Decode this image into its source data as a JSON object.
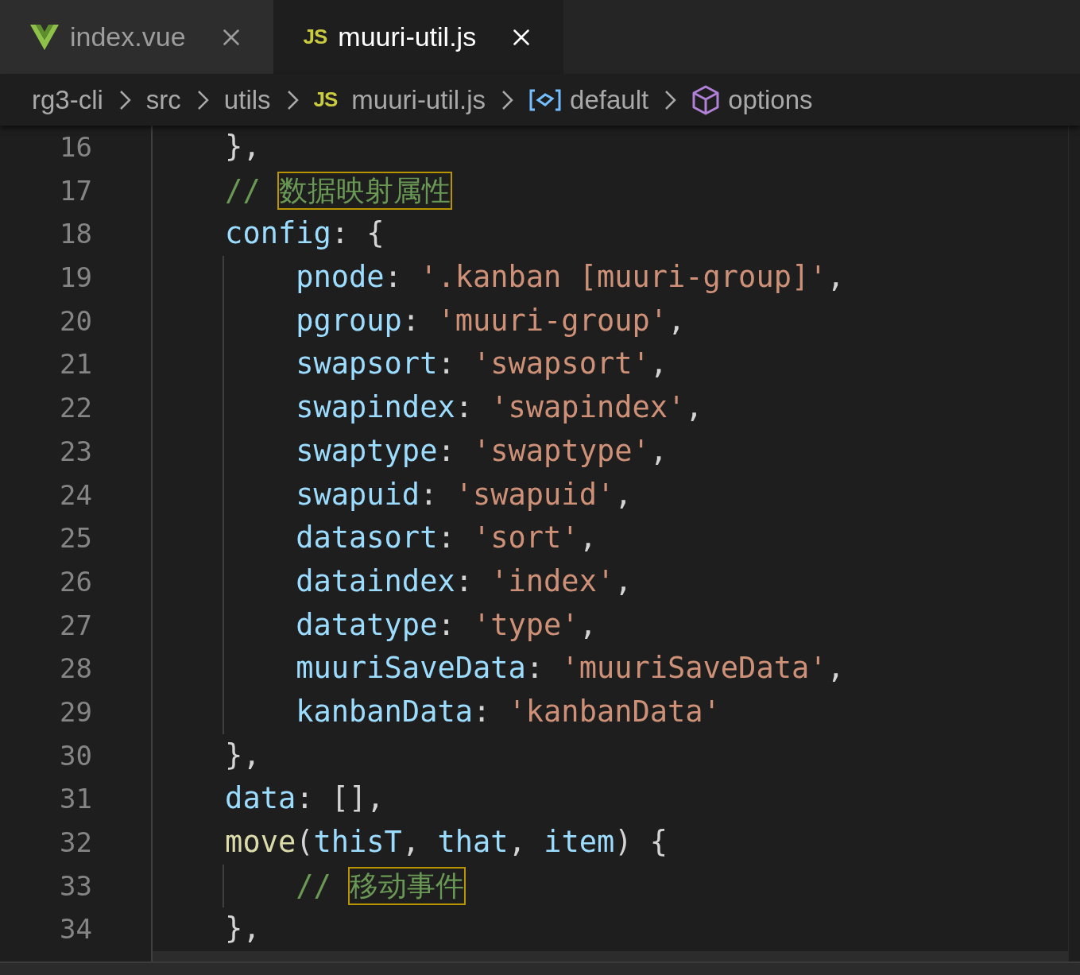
{
  "tabs": [
    {
      "kind": "vue",
      "label": "index.vue",
      "selected": false
    },
    {
      "kind": "js",
      "icon_text": "JS",
      "label": "muuri-util.js",
      "selected": true
    }
  ],
  "breadcrumbs": [
    {
      "kind": "folder",
      "label": "rg3-cli"
    },
    {
      "kind": "folder",
      "label": "src"
    },
    {
      "kind": "folder",
      "label": "utils"
    },
    {
      "kind": "js",
      "icon_text": "JS",
      "label": "muuri-util.js"
    },
    {
      "kind": "module",
      "label": "default"
    },
    {
      "kind": "property",
      "label": "options"
    }
  ],
  "lines": [
    {
      "number": "16",
      "tokens": [
        {
          "kind": "punct",
          "text": "    },"
        }
      ]
    },
    {
      "number": "17",
      "tokens": [
        {
          "kind": "comment",
          "text": "    // "
        },
        {
          "kind": "comment-highlighted",
          "text": "数据映射属性"
        }
      ]
    },
    {
      "number": "18",
      "tokens": [
        {
          "kind": "key",
          "text": "    config"
        },
        {
          "kind": "punct",
          "text": ": {"
        }
      ]
    },
    {
      "number": "19",
      "tokens": [
        {
          "kind": "key",
          "text": "        pnode"
        },
        {
          "kind": "punct",
          "text": ": "
        },
        {
          "kind": "string",
          "text": "'.kanban [muuri-group]'"
        },
        {
          "kind": "punct",
          "text": ","
        }
      ]
    },
    {
      "number": "20",
      "tokens": [
        {
          "kind": "key",
          "text": "        pgroup"
        },
        {
          "kind": "punct",
          "text": ": "
        },
        {
          "kind": "string",
          "text": "'muuri-group'"
        },
        {
          "kind": "punct",
          "text": ","
        }
      ]
    },
    {
      "number": "21",
      "tokens": [
        {
          "kind": "key",
          "text": "        swapsort"
        },
        {
          "kind": "punct",
          "text": ": "
        },
        {
          "kind": "string",
          "text": "'swapsort'"
        },
        {
          "kind": "punct",
          "text": ","
        }
      ]
    },
    {
      "number": "22",
      "tokens": [
        {
          "kind": "key",
          "text": "        swapindex"
        },
        {
          "kind": "punct",
          "text": ": "
        },
        {
          "kind": "string",
          "text": "'swapindex'"
        },
        {
          "kind": "punct",
          "text": ","
        }
      ]
    },
    {
      "number": "23",
      "tokens": [
        {
          "kind": "key",
          "text": "        swaptype"
        },
        {
          "kind": "punct",
          "text": ": "
        },
        {
          "kind": "string",
          "text": "'swaptype'"
        },
        {
          "kind": "punct",
          "text": ","
        }
      ]
    },
    {
      "number": "24",
      "tokens": [
        {
          "kind": "key",
          "text": "        swapuid"
        },
        {
          "kind": "punct",
          "text": ": "
        },
        {
          "kind": "string",
          "text": "'swapuid'"
        },
        {
          "kind": "punct",
          "text": ","
        }
      ]
    },
    {
      "number": "25",
      "tokens": [
        {
          "kind": "key",
          "text": "        datasort"
        },
        {
          "kind": "punct",
          "text": ": "
        },
        {
          "kind": "string",
          "text": "'sort'"
        },
        {
          "kind": "punct",
          "text": ","
        }
      ]
    },
    {
      "number": "26",
      "tokens": [
        {
          "kind": "key",
          "text": "        dataindex"
        },
        {
          "kind": "punct",
          "text": ": "
        },
        {
          "kind": "string",
          "text": "'index'"
        },
        {
          "kind": "punct",
          "text": ","
        }
      ]
    },
    {
      "number": "27",
      "tokens": [
        {
          "kind": "key",
          "text": "        datatype"
        },
        {
          "kind": "punct",
          "text": ": "
        },
        {
          "kind": "string",
          "text": "'type'"
        },
        {
          "kind": "punct",
          "text": ","
        }
      ]
    },
    {
      "number": "28",
      "tokens": [
        {
          "kind": "key",
          "text": "        muuriSaveData"
        },
        {
          "kind": "punct",
          "text": ": "
        },
        {
          "kind": "string",
          "text": "'muuriSaveData'"
        },
        {
          "kind": "punct",
          "text": ","
        }
      ]
    },
    {
      "number": "29",
      "tokens": [
        {
          "kind": "key",
          "text": "        kanbanData"
        },
        {
          "kind": "punct",
          "text": ": "
        },
        {
          "kind": "string",
          "text": "'kanbanData'"
        }
      ]
    },
    {
      "number": "30",
      "tokens": [
        {
          "kind": "punct",
          "text": "    },"
        }
      ]
    },
    {
      "number": "31",
      "tokens": [
        {
          "kind": "key",
          "text": "    data"
        },
        {
          "kind": "punct",
          "text": ": [],"
        }
      ]
    },
    {
      "number": "32",
      "tokens": [
        {
          "kind": "func",
          "text": "    move"
        },
        {
          "kind": "punct",
          "text": "("
        },
        {
          "kind": "param",
          "text": "thisT"
        },
        {
          "kind": "punct",
          "text": ", "
        },
        {
          "kind": "param",
          "text": "that"
        },
        {
          "kind": "punct",
          "text": ", "
        },
        {
          "kind": "param",
          "text": "item"
        },
        {
          "kind": "punct",
          "text": ") {"
        }
      ]
    },
    {
      "number": "33",
      "tokens": [
        {
          "kind": "comment",
          "text": "        // "
        },
        {
          "kind": "comment-highlighted",
          "text": "移动事件"
        }
      ]
    },
    {
      "number": "34",
      "tokens": [
        {
          "kind": "punct",
          "text": "    },"
        }
      ]
    }
  ]
}
